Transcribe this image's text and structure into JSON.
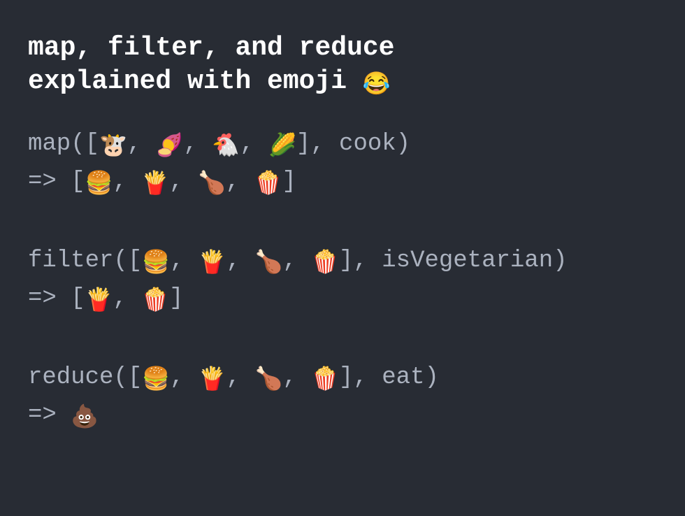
{
  "heading": {
    "line1": "map, filter, and reduce",
    "line2_prefix": "explained with emoji ",
    "line2_emoji": "😂"
  },
  "map": {
    "prefix": "map([",
    "items": [
      "🐮",
      "🍠",
      "🐔",
      "🌽"
    ],
    "sep": ", ",
    "suffix": "], cook)",
    "result_prefix": "=> [",
    "result_items": [
      "🍔",
      "🍟",
      "🍗",
      "🍿"
    ],
    "result_suffix": "]"
  },
  "filter": {
    "prefix": "filter([",
    "items": [
      "🍔",
      "🍟",
      "🍗",
      "🍿"
    ],
    "sep": ", ",
    "suffix": "], isVegetarian)",
    "result_prefix": "=> [",
    "result_items": [
      "🍟",
      "🍿"
    ],
    "result_suffix": "]"
  },
  "reduce": {
    "prefix": "reduce([",
    "items": [
      "🍔",
      "🍟",
      "🍗",
      "🍿"
    ],
    "sep": ", ",
    "suffix": "], eat)",
    "result_prefix": "=> ",
    "result_items": [
      "💩"
    ],
    "result_suffix": ""
  }
}
